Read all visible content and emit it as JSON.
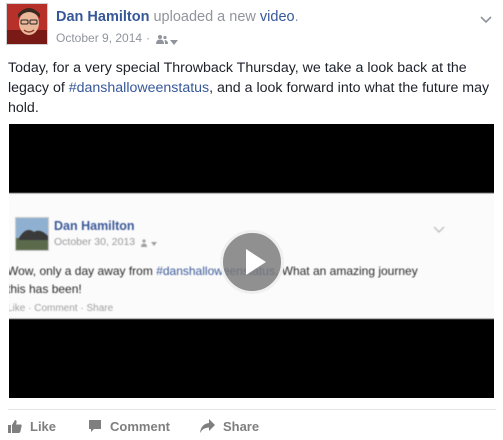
{
  "post": {
    "author": "Dan Hamilton",
    "action_prefix": "uploaded a new",
    "action_link": "video",
    "action_suffix": ".",
    "date": "October 9, 2014",
    "separator": "·",
    "text_before": "Today, for a very special Throwback Thursday, we take a look back at the legacy of ",
    "hashtag": "#danshalloweenstatus",
    "text_after": ", and a look forward into what the future may hold."
  },
  "video": {
    "inner_post": {
      "author": "Dan Hamilton",
      "date": "October 30, 2013",
      "text_before": "Wow, only a day away from ",
      "hashtag": "#danshalloweenstatus",
      "text_after": ". What an amazing journey this has been!",
      "actions": "Like · Comment · Share"
    }
  },
  "actions": {
    "like": "Like",
    "comment": "Comment",
    "share": "Share"
  },
  "colors": {
    "link": "#365899",
    "meta": "#90949c",
    "action": "#7f7f7f"
  },
  "icons": {
    "audience": "friends-icon",
    "privacy_caret": "caret-down-icon",
    "options": "chevron-down-icon",
    "play": "play-icon",
    "like": "thumbs-up-icon",
    "comment": "speech-bubble-icon",
    "share": "share-arrow-icon"
  }
}
